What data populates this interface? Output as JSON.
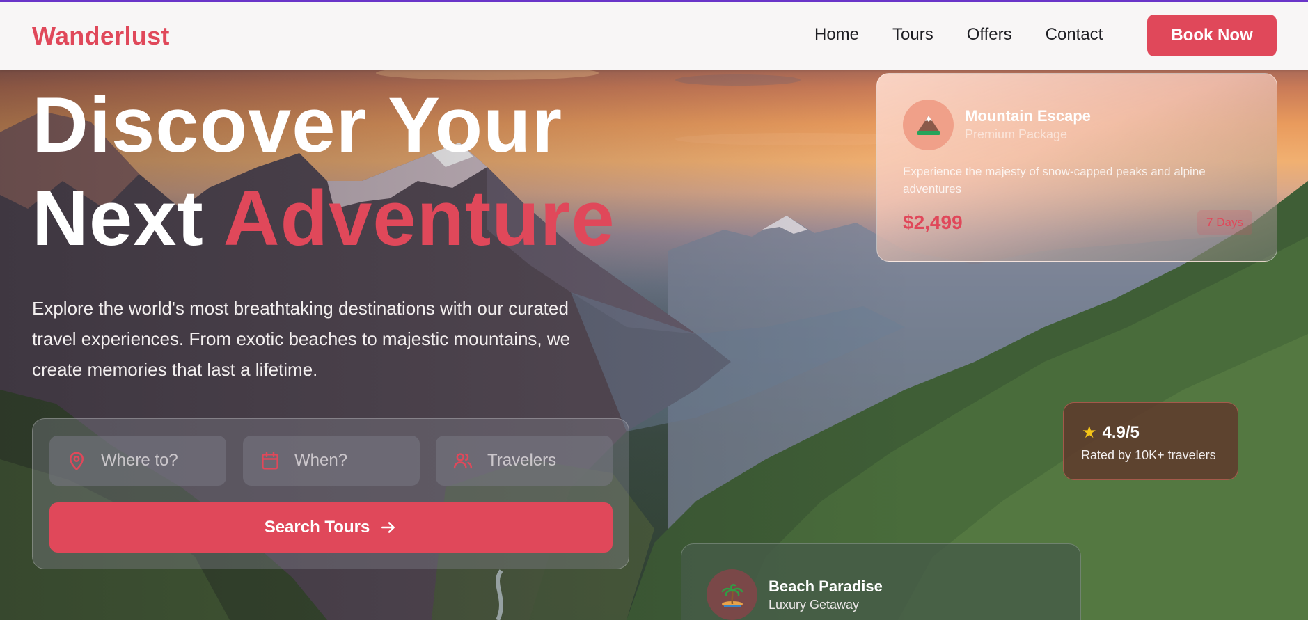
{
  "nav": {
    "brand": "Wanderlust",
    "links": [
      "Home",
      "Tours",
      "Offers",
      "Contact"
    ],
    "cta": "Book Now"
  },
  "hero": {
    "headline_line1": "Discover Your",
    "headline_line2_plain": "Next",
    "headline_line2_accent": "Adventure",
    "subtitle": "Explore the world's most breathtaking destinations with our curated travel experiences. From exotic beaches to majestic mountains, we create memories that last a lifetime."
  },
  "search": {
    "fields": [
      {
        "icon": "map-pin-icon",
        "placeholder": "Where to?"
      },
      {
        "icon": "calendar-icon",
        "placeholder": "When?"
      },
      {
        "icon": "users-icon",
        "placeholder": "Travelers"
      }
    ],
    "button_label": "Search Tours",
    "button_icon": "arrow-right-icon"
  },
  "cards": {
    "mountain": {
      "icon": "mountain-icon",
      "title": "Mountain Escape",
      "subtitle": "Premium Package",
      "description": "Experience the majesty of snow-capped peaks and alpine adventures",
      "price": "$2,499",
      "duration": "7 Days"
    },
    "rating": {
      "icon": "star-icon",
      "score": "4.9/5",
      "caption": "Rated by 10K+ travelers"
    },
    "beach": {
      "icon": "palm-island-icon",
      "title": "Beach Paradise",
      "subtitle": "Luxury Getaway"
    }
  },
  "colors": {
    "accent": "#e0485a",
    "nav_bg": "#f8f6f6",
    "text_dark": "#1f1f24"
  }
}
